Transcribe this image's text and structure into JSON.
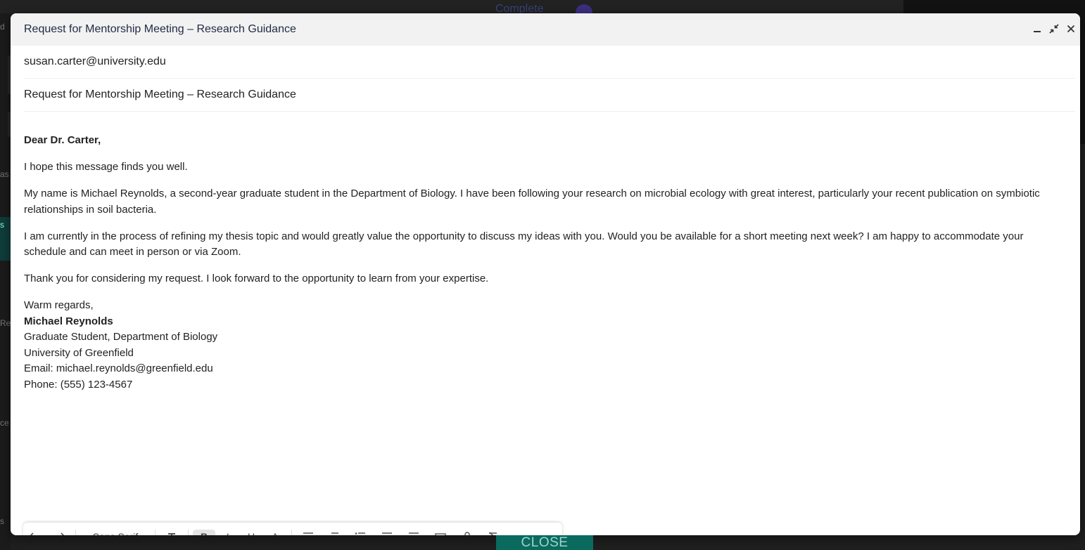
{
  "background": {
    "top_link_label": "Complete",
    "left_fragments": [
      "d",
      "as",
      "s",
      "Re",
      "ce",
      "s"
    ]
  },
  "compose": {
    "window_title": "Request for Mentorship Meeting – Research Guidance",
    "controls": {
      "minimize_icon": "minimize-icon",
      "exit_fullscreen_icon": "exit-fullscreen-icon",
      "close_icon": "close-icon"
    },
    "to": "susan.carter@university.edu",
    "subject": "Request for Mentorship Meeting – Research Guidance",
    "body": {
      "greeting": "Dear Dr. Carter,",
      "p1": "I hope this message finds you well.",
      "p2": "My name is Michael Reynolds, a second-year graduate student in the Department of Biology. I have been following your research on microbial ecology with great interest, particularly your recent publication on symbiotic relationships in soil bacteria.",
      "p3": "I am currently in the process of refining my thesis topic and would greatly value the opportunity to discuss my ideas with you. Would you be available for a short meeting next week? I am happy to accommodate your schedule and can meet in person or via Zoom.",
      "p4": "Thank you for considering my request. I look forward to the opportunity to learn from your expertise.",
      "closing": "Warm regards,",
      "sig_name": "Michael Reynolds",
      "sig_title": "Graduate Student, Department of Biology",
      "sig_org": "University of Greenfield",
      "sig_email": "Email: michael.reynolds@greenfield.edu",
      "sig_phone": "Phone: (555) 123-4567"
    }
  },
  "toolbar": {
    "undo_icon": "undo-icon",
    "redo_icon": "redo-icon",
    "font_label": "Sans Serif",
    "font_size_icon": "font-size-icon",
    "bold_label": "B",
    "italic_label": "I",
    "underline_label": "U",
    "text_color_label": "A"
  },
  "close_button_label": "CLOSE"
}
